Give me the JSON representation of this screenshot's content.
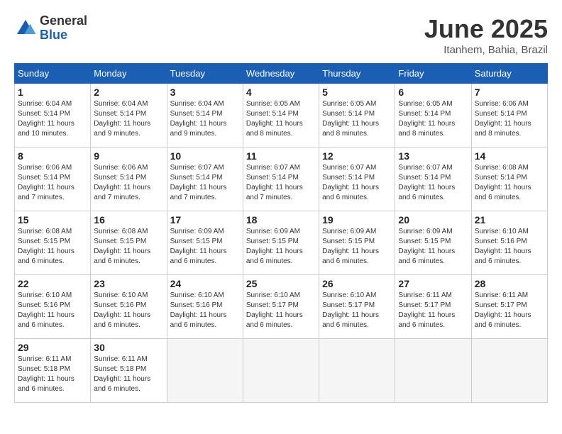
{
  "header": {
    "logo": {
      "general": "General",
      "blue": "Blue"
    },
    "title": "June 2025",
    "location": "Itanhem, Bahia, Brazil"
  },
  "columns": [
    "Sunday",
    "Monday",
    "Tuesday",
    "Wednesday",
    "Thursday",
    "Friday",
    "Saturday"
  ],
  "weeks": [
    [
      {
        "day": "1",
        "sunrise": "6:04 AM",
        "sunset": "5:14 PM",
        "daylight": "11 hours and 10 minutes."
      },
      {
        "day": "2",
        "sunrise": "6:04 AM",
        "sunset": "5:14 PM",
        "daylight": "11 hours and 9 minutes."
      },
      {
        "day": "3",
        "sunrise": "6:04 AM",
        "sunset": "5:14 PM",
        "daylight": "11 hours and 9 minutes."
      },
      {
        "day": "4",
        "sunrise": "6:05 AM",
        "sunset": "5:14 PM",
        "daylight": "11 hours and 8 minutes."
      },
      {
        "day": "5",
        "sunrise": "6:05 AM",
        "sunset": "5:14 PM",
        "daylight": "11 hours and 8 minutes."
      },
      {
        "day": "6",
        "sunrise": "6:05 AM",
        "sunset": "5:14 PM",
        "daylight": "11 hours and 8 minutes."
      },
      {
        "day": "7",
        "sunrise": "6:06 AM",
        "sunset": "5:14 PM",
        "daylight": "11 hours and 8 minutes."
      }
    ],
    [
      {
        "day": "8",
        "sunrise": "6:06 AM",
        "sunset": "5:14 PM",
        "daylight": "11 hours and 7 minutes."
      },
      {
        "day": "9",
        "sunrise": "6:06 AM",
        "sunset": "5:14 PM",
        "daylight": "11 hours and 7 minutes."
      },
      {
        "day": "10",
        "sunrise": "6:07 AM",
        "sunset": "5:14 PM",
        "daylight": "11 hours and 7 minutes."
      },
      {
        "day": "11",
        "sunrise": "6:07 AM",
        "sunset": "5:14 PM",
        "daylight": "11 hours and 7 minutes."
      },
      {
        "day": "12",
        "sunrise": "6:07 AM",
        "sunset": "5:14 PM",
        "daylight": "11 hours and 6 minutes."
      },
      {
        "day": "13",
        "sunrise": "6:07 AM",
        "sunset": "5:14 PM",
        "daylight": "11 hours and 6 minutes."
      },
      {
        "day": "14",
        "sunrise": "6:08 AM",
        "sunset": "5:14 PM",
        "daylight": "11 hours and 6 minutes."
      }
    ],
    [
      {
        "day": "15",
        "sunrise": "6:08 AM",
        "sunset": "5:15 PM",
        "daylight": "11 hours and 6 minutes."
      },
      {
        "day": "16",
        "sunrise": "6:08 AM",
        "sunset": "5:15 PM",
        "daylight": "11 hours and 6 minutes."
      },
      {
        "day": "17",
        "sunrise": "6:09 AM",
        "sunset": "5:15 PM",
        "daylight": "11 hours and 6 minutes."
      },
      {
        "day": "18",
        "sunrise": "6:09 AM",
        "sunset": "5:15 PM",
        "daylight": "11 hours and 6 minutes."
      },
      {
        "day": "19",
        "sunrise": "6:09 AM",
        "sunset": "5:15 PM",
        "daylight": "11 hours and 6 minutes."
      },
      {
        "day": "20",
        "sunrise": "6:09 AM",
        "sunset": "5:15 PM",
        "daylight": "11 hours and 6 minutes."
      },
      {
        "day": "21",
        "sunrise": "6:10 AM",
        "sunset": "5:16 PM",
        "daylight": "11 hours and 6 minutes."
      }
    ],
    [
      {
        "day": "22",
        "sunrise": "6:10 AM",
        "sunset": "5:16 PM",
        "daylight": "11 hours and 6 minutes."
      },
      {
        "day": "23",
        "sunrise": "6:10 AM",
        "sunset": "5:16 PM",
        "daylight": "11 hours and 6 minutes."
      },
      {
        "day": "24",
        "sunrise": "6:10 AM",
        "sunset": "5:16 PM",
        "daylight": "11 hours and 6 minutes."
      },
      {
        "day": "25",
        "sunrise": "6:10 AM",
        "sunset": "5:17 PM",
        "daylight": "11 hours and 6 minutes."
      },
      {
        "day": "26",
        "sunrise": "6:10 AM",
        "sunset": "5:17 PM",
        "daylight": "11 hours and 6 minutes."
      },
      {
        "day": "27",
        "sunrise": "6:11 AM",
        "sunset": "5:17 PM",
        "daylight": "11 hours and 6 minutes."
      },
      {
        "day": "28",
        "sunrise": "6:11 AM",
        "sunset": "5:17 PM",
        "daylight": "11 hours and 6 minutes."
      }
    ],
    [
      {
        "day": "29",
        "sunrise": "6:11 AM",
        "sunset": "5:18 PM",
        "daylight": "11 hours and 6 minutes."
      },
      {
        "day": "30",
        "sunrise": "6:11 AM",
        "sunset": "5:18 PM",
        "daylight": "11 hours and 6 minutes."
      },
      null,
      null,
      null,
      null,
      null
    ]
  ],
  "labels": {
    "sunrise": "Sunrise:",
    "sunset": "Sunset:",
    "daylight": "Daylight:"
  }
}
